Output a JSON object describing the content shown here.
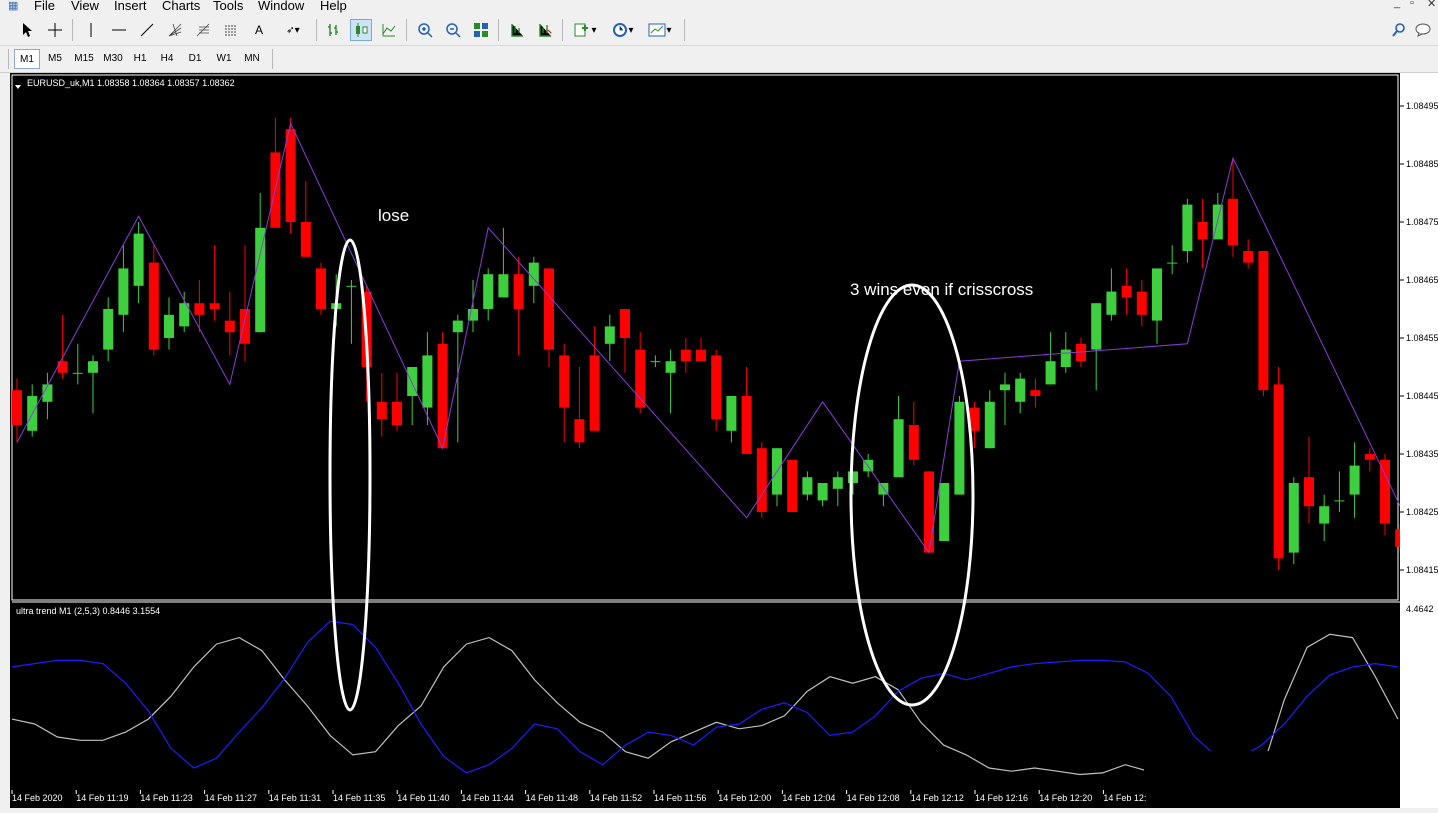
{
  "menu": {
    "items": [
      "File",
      "View",
      "Insert",
      "Charts",
      "Tools",
      "Window",
      "Help"
    ],
    "window_controls": [
      "_",
      "▫",
      "✕"
    ]
  },
  "toolbar": {
    "icons": [
      "cursor-arrow-icon",
      "crosshair-icon",
      "vertical-line-icon",
      "horizontal-line-icon",
      "trendline-icon",
      "fibonacci-fan-icon",
      "fibonacci-icon",
      "channel-icon",
      "text-icon",
      "arrows-dropdown-icon",
      "bar-chart-icon",
      "candlestick-icon",
      "line-chart-icon",
      "zoom-in-icon",
      "zoom-out-icon",
      "tile-windows-icon",
      "chart-shift-icon",
      "autoscroll-icon",
      "indicators-icon",
      "periods-icon",
      "templates-icon",
      "search-icon",
      "chat-icon"
    ]
  },
  "timeframes": [
    "M1",
    "M5",
    "M15",
    "M30",
    "H1",
    "H4",
    "D1",
    "W1",
    "MN"
  ],
  "active_timeframe": "M1",
  "chart": {
    "header": "EURUSD_uk,M1  1.08358 1.08364 1.08357 1.08362",
    "indicator_header": "ultra trend M1 (2,5,3) 0.8446 3.1554",
    "indicator_scale_top": "4.4642",
    "price_ticks": [
      "1.08495",
      "1.08485",
      "1.08475",
      "1.08465",
      "1.08455",
      "1.08445",
      "1.08435",
      "1.08425",
      "1.08415"
    ],
    "time_ticks": [
      "14 Feb 2020",
      "14 Feb 11:19",
      "14 Feb 11:23",
      "14 Feb 11:27",
      "14 Feb 11:31",
      "14 Feb 11:35",
      "14 Feb 11:40",
      "14 Feb 11:44",
      "14 Feb 11:48",
      "14 Feb 11:52",
      "14 Feb 11:56",
      "14 Feb 12:00",
      "14 Feb 12:04",
      "14 Feb 12:08",
      "14 Feb 12:12",
      "14 Feb 12:16",
      "14 Feb 12:20",
      "14 Feb 12:"
    ],
    "annotations": {
      "lose": "lose",
      "wins": "3 wins even if crisscross"
    },
    "colors": {
      "bull": "#3ecf3e",
      "bear": "#ff0000",
      "zigzag": "#8a3dd6",
      "blue_line": "#1d1dff",
      "gray_line": "#c0c0c0",
      "annotation": "#ffffff"
    }
  },
  "chart_data": {
    "type": "candlestick",
    "candles": [
      {
        "o": 1.08446,
        "h": 1.08448,
        "l": 1.08437,
        "c": 1.0844
      },
      {
        "o": 1.08439,
        "h": 1.08447,
        "l": 1.08438,
        "c": 1.08445
      },
      {
        "o": 1.08444,
        "h": 1.08449,
        "l": 1.08441,
        "c": 1.08447
      },
      {
        "o": 1.08451,
        "h": 1.08459,
        "l": 1.08448,
        "c": 1.08449
      },
      {
        "o": 1.08449,
        "h": 1.08454,
        "l": 1.08447,
        "c": 1.08449
      },
      {
        "o": 1.08449,
        "h": 1.08452,
        "l": 1.08442,
        "c": 1.08451
      },
      {
        "o": 1.08453,
        "h": 1.08462,
        "l": 1.08451,
        "c": 1.0846
      },
      {
        "o": 1.08459,
        "h": 1.08471,
        "l": 1.08456,
        "c": 1.08467
      },
      {
        "o": 1.08464,
        "h": 1.08475,
        "l": 1.08461,
        "c": 1.08473
      },
      {
        "o": 1.08468,
        "h": 1.08471,
        "l": 1.08452,
        "c": 1.08453
      },
      {
        "o": 1.08455,
        "h": 1.08462,
        "l": 1.08453,
        "c": 1.08459
      },
      {
        "o": 1.08457,
        "h": 1.08463,
        "l": 1.08456,
        "c": 1.08461
      },
      {
        "o": 1.08461,
        "h": 1.08465,
        "l": 1.08456,
        "c": 1.08459
      },
      {
        "o": 1.08461,
        "h": 1.08471,
        "l": 1.08458,
        "c": 1.0846
      },
      {
        "o": 1.08458,
        "h": 1.08463,
        "l": 1.08452,
        "c": 1.08456
      },
      {
        "o": 1.0846,
        "h": 1.08471,
        "l": 1.08451,
        "c": 1.08454
      },
      {
        "o": 1.08456,
        "h": 1.0848,
        "l": 1.08456,
        "c": 1.08474
      },
      {
        "o": 1.08487,
        "h": 1.08493,
        "l": 1.08474,
        "c": 1.08474
      },
      {
        "o": 1.08491,
        "h": 1.08493,
        "l": 1.08473,
        "c": 1.08475
      },
      {
        "o": 1.08475,
        "h": 1.08482,
        "l": 1.08469,
        "c": 1.08469
      },
      {
        "o": 1.08467,
        "h": 1.08468,
        "l": 1.08459,
        "c": 1.0846
      },
      {
        "o": 1.0846,
        "h": 1.08466,
        "l": 1.08457,
        "c": 1.08461
      },
      {
        "o": 1.08464,
        "h": 1.08465,
        "l": 1.08454,
        "c": 1.08464
      },
      {
        "o": 1.08463,
        "h": 1.08464,
        "l": 1.08444,
        "c": 1.0845
      },
      {
        "o": 1.08444,
        "h": 1.08449,
        "l": 1.08438,
        "c": 1.08441
      },
      {
        "o": 1.08444,
        "h": 1.08449,
        "l": 1.08439,
        "c": 1.0844
      },
      {
        "o": 1.08445,
        "h": 1.0845,
        "l": 1.0844,
        "c": 1.0845
      },
      {
        "o": 1.08443,
        "h": 1.08456,
        "l": 1.0844,
        "c": 1.08452
      },
      {
        "o": 1.08454,
        "h": 1.08456,
        "l": 1.08436,
        "c": 1.08436
      },
      {
        "o": 1.08456,
        "h": 1.08459,
        "l": 1.08437,
        "c": 1.08458
      },
      {
        "o": 1.08458,
        "h": 1.08465,
        "l": 1.08456,
        "c": 1.0846
      },
      {
        "o": 1.0846,
        "h": 1.08467,
        "l": 1.08458,
        "c": 1.08466
      },
      {
        "o": 1.08462,
        "h": 1.08474,
        "l": 1.08462,
        "c": 1.08466
      },
      {
        "o": 1.08466,
        "h": 1.08469,
        "l": 1.08452,
        "c": 1.0846
      },
      {
        "o": 1.08464,
        "h": 1.08469,
        "l": 1.08461,
        "c": 1.08468
      },
      {
        "o": 1.08467,
        "h": 1.08467,
        "l": 1.0845,
        "c": 1.08453
      },
      {
        "o": 1.08452,
        "h": 1.08454,
        "l": 1.08437,
        "c": 1.08443
      },
      {
        "o": 1.08441,
        "h": 1.0845,
        "l": 1.08436,
        "c": 1.08437
      },
      {
        "o": 1.08452,
        "h": 1.08457,
        "l": 1.0844,
        "c": 1.08439
      },
      {
        "o": 1.08454,
        "h": 1.08459,
        "l": 1.08451,
        "c": 1.08457
      },
      {
        "o": 1.0846,
        "h": 1.0846,
        "l": 1.08449,
        "c": 1.08455
      },
      {
        "o": 1.08453,
        "h": 1.08456,
        "l": 1.08442,
        "c": 1.08443
      },
      {
        "o": 1.08451,
        "h": 1.08452,
        "l": 1.0845,
        "c": 1.08451
      },
      {
        "o": 1.08449,
        "h": 1.08453,
        "l": 1.08442,
        "c": 1.08451
      },
      {
        "o": 1.08453,
        "h": 1.08455,
        "l": 1.08449,
        "c": 1.08451
      },
      {
        "o": 1.08453,
        "h": 1.08455,
        "l": 1.08452,
        "c": 1.08451
      },
      {
        "o": 1.08452,
        "h": 1.08453,
        "l": 1.08439,
        "c": 1.08441
      },
      {
        "o": 1.08439,
        "h": 1.0844,
        "l": 1.08437,
        "c": 1.08445
      },
      {
        "o": 1.08445,
        "h": 1.0845,
        "l": 1.08435,
        "c": 1.08435
      },
      {
        "o": 1.08436,
        "h": 1.08437,
        "l": 1.08424,
        "c": 1.08425
      },
      {
        "o": 1.08428,
        "h": 1.08436,
        "l": 1.08426,
        "c": 1.08436
      },
      {
        "o": 1.08434,
        "h": 1.08434,
        "l": 1.08425,
        "c": 1.08425
      },
      {
        "o": 1.08428,
        "h": 1.08432,
        "l": 1.08427,
        "c": 1.08431
      },
      {
        "o": 1.08427,
        "h": 1.0843,
        "l": 1.08426,
        "c": 1.0843
      },
      {
        "o": 1.08429,
        "h": 1.08432,
        "l": 1.08426,
        "c": 1.08431
      },
      {
        "o": 1.0843,
        "h": 1.08432,
        "l": 1.08428,
        "c": 1.08432
      },
      {
        "o": 1.08432,
        "h": 1.08435,
        "l": 1.08431,
        "c": 1.08434
      },
      {
        "o": 1.08428,
        "h": 1.08429,
        "l": 1.08426,
        "c": 1.0843
      },
      {
        "o": 1.08431,
        "h": 1.08445,
        "l": 1.08431,
        "c": 1.08441
      },
      {
        "o": 1.0844,
        "h": 1.08444,
        "l": 1.08433,
        "c": 1.08434
      },
      {
        "o": 1.08432,
        "h": 1.08432,
        "l": 1.08418,
        "c": 1.08418
      },
      {
        "o": 1.0842,
        "h": 1.0843,
        "l": 1.0842,
        "c": 1.0843
      },
      {
        "o": 1.08428,
        "h": 1.08445,
        "l": 1.08428,
        "c": 1.08444
      },
      {
        "o": 1.08443,
        "h": 1.08444,
        "l": 1.08436,
        "c": 1.08439
      },
      {
        "o": 1.08436,
        "h": 1.08446,
        "l": 1.08436,
        "c": 1.08444
      },
      {
        "o": 1.08446,
        "h": 1.08449,
        "l": 1.0844,
        "c": 1.08447
      },
      {
        "o": 1.08444,
        "h": 1.08449,
        "l": 1.08442,
        "c": 1.08448
      },
      {
        "o": 1.08446,
        "h": 1.08448,
        "l": 1.08443,
        "c": 1.08445
      },
      {
        "o": 1.08447,
        "h": 1.08456,
        "l": 1.08447,
        "c": 1.08451
      },
      {
        "o": 1.0845,
        "h": 1.08456,
        "l": 1.08449,
        "c": 1.08453
      },
      {
        "o": 1.08454,
        "h": 1.08455,
        "l": 1.0845,
        "c": 1.08451
      },
      {
        "o": 1.08453,
        "h": 1.0846,
        "l": 1.08446,
        "c": 1.08461
      },
      {
        "o": 1.08459,
        "h": 1.08467,
        "l": 1.08458,
        "c": 1.08463
      },
      {
        "o": 1.08464,
        "h": 1.08467,
        "l": 1.08459,
        "c": 1.08462
      },
      {
        "o": 1.08463,
        "h": 1.08465,
        "l": 1.08457,
        "c": 1.08459
      },
      {
        "o": 1.08458,
        "h": 1.08464,
        "l": 1.08454,
        "c": 1.08467
      },
      {
        "o": 1.08468,
        "h": 1.08471,
        "l": 1.08466,
        "c": 1.08468
      },
      {
        "o": 1.0847,
        "h": 1.08479,
        "l": 1.08468,
        "c": 1.08478
      },
      {
        "o": 1.08475,
        "h": 1.08479,
        "l": 1.08467,
        "c": 1.08472
      },
      {
        "o": 1.08472,
        "h": 1.0848,
        "l": 1.08473,
        "c": 1.08478
      },
      {
        "o": 1.08479,
        "h": 1.08486,
        "l": 1.08469,
        "c": 1.08471
      },
      {
        "o": 1.0847,
        "h": 1.08472,
        "l": 1.08467,
        "c": 1.08468
      },
      {
        "o": 1.0847,
        "h": 1.0847,
        "l": 1.08445,
        "c": 1.08446
      },
      {
        "o": 1.08447,
        "h": 1.0845,
        "l": 1.08415,
        "c": 1.08417
      },
      {
        "o": 1.08418,
        "h": 1.08431,
        "l": 1.08416,
        "c": 1.0843
      },
      {
        "o": 1.08431,
        "h": 1.08438,
        "l": 1.08423,
        "c": 1.08426
      },
      {
        "o": 1.08423,
        "h": 1.08428,
        "l": 1.0842,
        "c": 1.08426
      },
      {
        "o": 1.08427,
        "h": 1.08432,
        "l": 1.08425,
        "c": 1.08427
      },
      {
        "o": 1.08428,
        "h": 1.08437,
        "l": 1.08424,
        "c": 1.08433
      },
      {
        "o": 1.08435,
        "h": 1.08436,
        "l": 1.08432,
        "c": 1.08434
      },
      {
        "o": 1.08434,
        "h": 1.08435,
        "l": 1.08421,
        "c": 1.08423
      },
      {
        "o": 1.08422,
        "h": 1.08423,
        "l": 1.08418,
        "c": 1.08419
      }
    ],
    "zigzag_price": [
      1.08437,
      1.08476,
      1.08447,
      1.08492,
      1.08436,
      1.08474,
      1.08424,
      1.08444,
      1.08418,
      1.08451,
      1.08454,
      1.08486,
      1.08426
    ],
    "zigzag_index": [
      0,
      8,
      14,
      18,
      28,
      31,
      48,
      53,
      60,
      62,
      77,
      80,
      91
    ],
    "indicator": {
      "blue": [
        0.7,
        0.72,
        0.74,
        0.74,
        0.72,
        0.6,
        0.43,
        0.2,
        0.08,
        0.14,
        0.3,
        0.45,
        0.63,
        0.85,
        0.98,
        0.96,
        0.82,
        0.6,
        0.35,
        0.15,
        0.05,
        0.1,
        0.2,
        0.35,
        0.32,
        0.18,
        0.1,
        0.22,
        0.3,
        0.28,
        0.22,
        0.33,
        0.35,
        0.44,
        0.48,
        0.42,
        0.28,
        0.3,
        0.4,
        0.55,
        0.63,
        0.66,
        0.62,
        0.66,
        0.7,
        0.72,
        0.73,
        0.74,
        0.74,
        0.73,
        0.66,
        0.52,
        0.28,
        0.15,
        0.14,
        0.22,
        0.35,
        0.52,
        0.65,
        0.7,
        0.72,
        0.7
      ],
      "gray": [
        0.38,
        0.35,
        0.27,
        0.25,
        0.25,
        0.3,
        0.38,
        0.52,
        0.7,
        0.84,
        0.88,
        0.8,
        0.62,
        0.46,
        0.28,
        0.16,
        0.18,
        0.34,
        0.46,
        0.7,
        0.84,
        0.88,
        0.8,
        0.62,
        0.48,
        0.36,
        0.3,
        0.18,
        0.14,
        0.24,
        0.3,
        0.36,
        0.32,
        0.34,
        0.4,
        0.55,
        0.64,
        0.6,
        0.64,
        0.56,
        0.36,
        0.22,
        0.16,
        0.08,
        0.06,
        0.08,
        0.06,
        0.04,
        0.05,
        0.1,
        0.06,
        0.02,
        0.02,
        0.02,
        0.02,
        0.06,
        0.5,
        0.82,
        0.9,
        0.88,
        0.64,
        0.38
      ]
    }
  }
}
